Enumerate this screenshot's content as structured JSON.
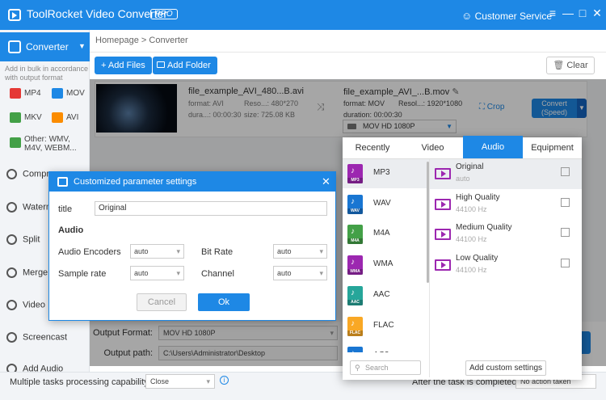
{
  "app": {
    "title": "ToolRocket Video Converter",
    "badge": "PRO",
    "customer_service": "Customer Service"
  },
  "window_controls": {
    "menu": "≡",
    "minimize": "—",
    "maximize": "□",
    "close": "✕"
  },
  "sidebar": {
    "active": "Converter",
    "hint": "Add in bulk in accordance with output format",
    "formats": [
      "MP4",
      "MOV",
      "MKV",
      "AVI",
      "Other: WMV, M4V, WEBM..."
    ],
    "items": [
      "Compr",
      "Waterm",
      "Split",
      "Merge",
      "Video",
      "Screencast",
      "Add Audio"
    ]
  },
  "breadcrumb": {
    "home": "Homepage",
    "sep": ">",
    "current": "Converter"
  },
  "toolbar": {
    "add_files": "+ Add Files",
    "add_folder": "Add Folder",
    "clear": "Clear"
  },
  "file": {
    "source_name": "file_example_AVI_480...B.avi",
    "source_format_label": "format:",
    "source_format": "AVI",
    "source_res_label": "Reso...:",
    "source_res": "480*270",
    "source_dur_label": "dura...:",
    "source_dur": "00:00:30",
    "source_size_label": "size:",
    "source_size": "725.08 KB",
    "target_name": "file_example_AVI_...B.mov",
    "target_format_label": "format:",
    "target_format": "MOV",
    "target_res_label": "Resol...:",
    "target_res": "1920*1080",
    "target_dur_label": "duration:",
    "target_dur": "00:00:30",
    "output_select": "MOV   HD 1080P",
    "crop": "Crop",
    "convert_line1": "Convert",
    "convert_line2": "(Speed)"
  },
  "output": {
    "format_label": "Output Format:",
    "format_value": "MOV   HD 1080P",
    "path_label": "Output path:",
    "path_value": "C:\\Users\\Administrator\\Desktop"
  },
  "status": {
    "tasks_label": "Multiple tasks processing capability",
    "tasks_value": "Close",
    "after_label": "After the task is completed",
    "after_value": "No action taken"
  },
  "dialog": {
    "title": "Customized parameter settings",
    "title_label": "title",
    "title_value": "Original",
    "section": "Audio",
    "encoders_label": "Audio Encoders",
    "encoders_value": "auto",
    "bitrate_label": "Bit Rate",
    "bitrate_value": "auto",
    "samplerate_label": "Sample rate",
    "samplerate_value": "auto",
    "channel_label": "Channel",
    "channel_value": "auto",
    "cancel": "Cancel",
    "ok": "Ok"
  },
  "format_popup": {
    "tabs": [
      "Recently",
      "Video",
      "Audio",
      "Equipment"
    ],
    "active_tab": "Audio",
    "audio_formats": [
      {
        "name": "MP3",
        "tag": "MP3",
        "color": "#9c27b0"
      },
      {
        "name": "WAV",
        "tag": "WAV",
        "color": "#1976d2"
      },
      {
        "name": "M4A",
        "tag": "M4A",
        "color": "#43a047"
      },
      {
        "name": "WMA",
        "tag": "WMA",
        "color": "#9c27b0"
      },
      {
        "name": "AAC",
        "tag": "AAC",
        "color": "#26a69a"
      },
      {
        "name": "FLAC",
        "tag": "FLAC",
        "color": "#f9a825"
      },
      {
        "name": "AC3",
        "tag": "AC3",
        "color": "#1976d2"
      }
    ],
    "qualities": [
      {
        "name": "Original",
        "sub": "auto"
      },
      {
        "name": "High Quality",
        "sub": "44100 Hz"
      },
      {
        "name": "Medium Quality",
        "sub": "44100 Hz"
      },
      {
        "name": "Low Quality",
        "sub": "44100 Hz"
      }
    ],
    "search_placeholder": "Search",
    "add_custom": "Add custom settings"
  }
}
